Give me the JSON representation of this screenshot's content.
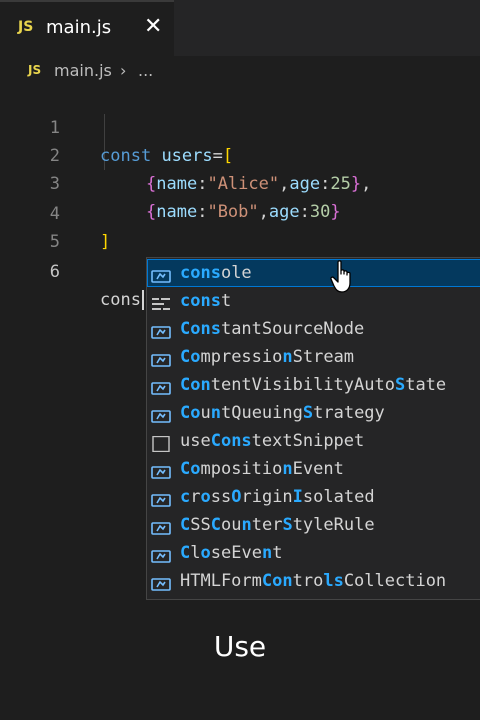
{
  "tab": {
    "badge": "JS",
    "title": "main.js",
    "close": "✕"
  },
  "breadcrumb": {
    "badge": "JS",
    "file": "main.js",
    "separator": "›",
    "more": "..."
  },
  "code": {
    "lines": [
      {
        "num": "1",
        "text": "const users=["
      },
      {
        "num": "2",
        "text": "{name:\"Alice\",age:25},"
      },
      {
        "num": "3",
        "text": "{name:\"Bob\",age:30}"
      },
      {
        "num": "4",
        "text": "]"
      },
      {
        "num": "5",
        "text": ""
      },
      {
        "num": "6",
        "text": "cons"
      }
    ],
    "active_line": "6"
  },
  "suggestions": [
    {
      "icon": "variable-icon",
      "parts": [
        [
          "cons",
          true
        ],
        [
          "ole",
          false
        ]
      ],
      "selected": true
    },
    {
      "icon": "keyword-icon",
      "parts": [
        [
          "cons",
          true
        ],
        [
          "t",
          false
        ]
      ]
    },
    {
      "icon": "variable-icon",
      "parts": [
        [
          "Cons",
          true
        ],
        [
          "tantSourceNode",
          false
        ]
      ]
    },
    {
      "icon": "variable-icon",
      "parts": [
        [
          "Co",
          true
        ],
        [
          "mpressio",
          false
        ],
        [
          "n",
          true
        ],
        [
          "Stream",
          false
        ]
      ]
    },
    {
      "icon": "variable-icon",
      "parts": [
        [
          "Con",
          true
        ],
        [
          "tentVisibilityAuto",
          false
        ],
        [
          "S",
          true
        ],
        [
          "tate",
          false
        ]
      ]
    },
    {
      "icon": "variable-icon",
      "parts": [
        [
          "Co",
          true
        ],
        [
          "u",
          false
        ],
        [
          "n",
          true
        ],
        [
          "tQueuing",
          false
        ],
        [
          "S",
          true
        ],
        [
          "trategy",
          false
        ]
      ]
    },
    {
      "icon": "snippet-icon",
      "parts": [
        [
          "use",
          false
        ],
        [
          "Cons",
          true
        ],
        [
          "textSnippet",
          false
        ]
      ]
    },
    {
      "icon": "variable-icon",
      "parts": [
        [
          "Co",
          true
        ],
        [
          "mpositio",
          false
        ],
        [
          "n",
          true
        ],
        [
          "Event",
          false
        ]
      ]
    },
    {
      "icon": "variable-icon",
      "parts": [
        [
          "c",
          true
        ],
        [
          "r",
          false
        ],
        [
          "o",
          true
        ],
        [
          "ss",
          false
        ],
        [
          "O",
          true
        ],
        [
          "rigin",
          false
        ],
        [
          "I",
          true
        ],
        [
          "solated",
          false
        ]
      ]
    },
    {
      "icon": "variable-icon",
      "parts": [
        [
          "C",
          true
        ],
        [
          "SS",
          false
        ],
        [
          "C",
          true
        ],
        [
          "ou",
          false
        ],
        [
          "n",
          true
        ],
        [
          "ter",
          false
        ],
        [
          "S",
          true
        ],
        [
          "tyleRule",
          false
        ]
      ]
    },
    {
      "icon": "variable-icon",
      "parts": [
        [
          "C",
          true
        ],
        [
          "l",
          false
        ],
        [
          "o",
          true
        ],
        [
          "seEve",
          false
        ],
        [
          "n",
          true
        ],
        [
          "t",
          false
        ]
      ]
    },
    {
      "icon": "variable-icon",
      "parts": [
        [
          "HTMLForm",
          false
        ],
        [
          "Con",
          true
        ],
        [
          "tro",
          false
        ],
        [
          "ls",
          true
        ],
        [
          "Collection",
          false
        ]
      ]
    }
  ],
  "caption": "Use"
}
